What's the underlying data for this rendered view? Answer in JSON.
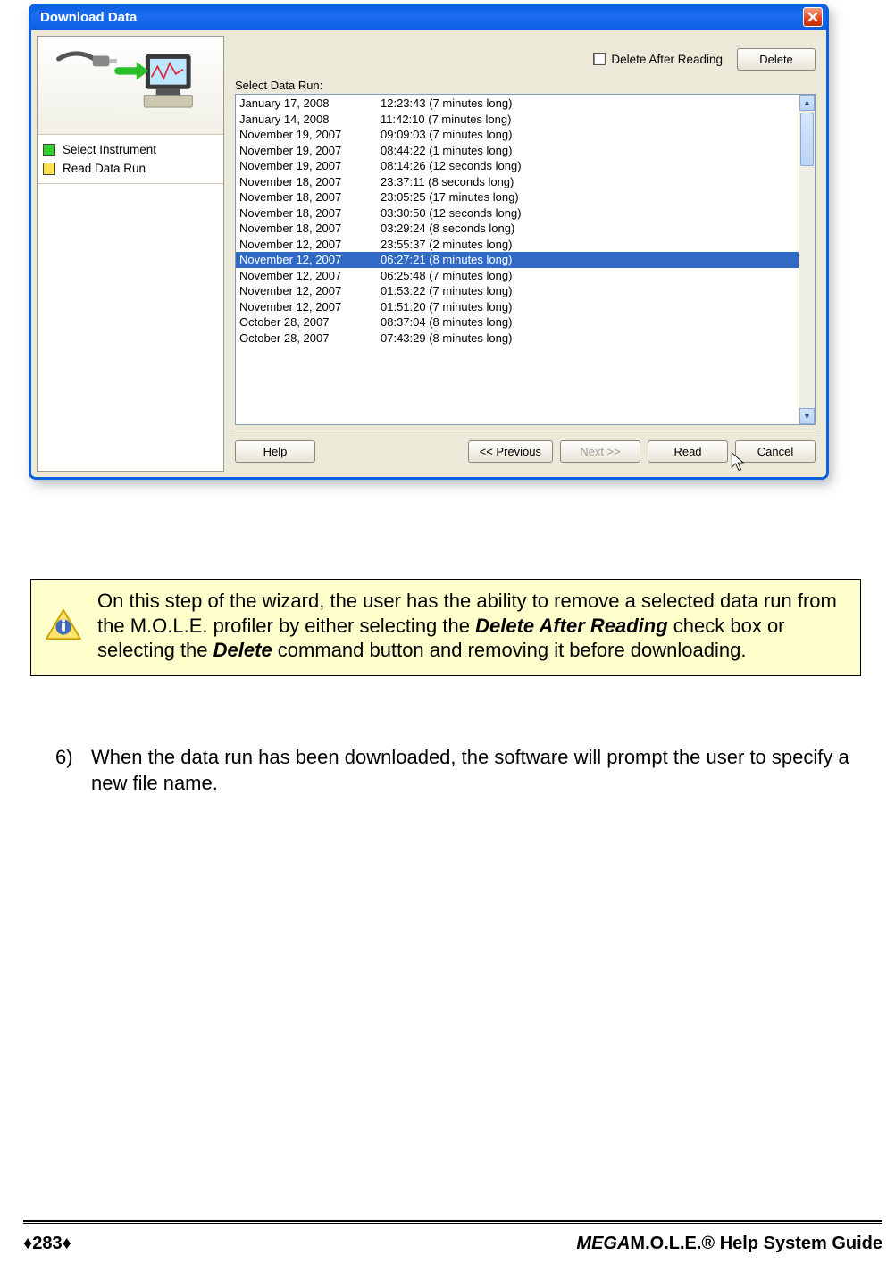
{
  "dialog": {
    "title": "Download Data",
    "steps": [
      {
        "color": "green",
        "label": "Select Instrument"
      },
      {
        "color": "yellow",
        "label": "Read Data Run"
      }
    ],
    "delete_after_reading_label": "Delete After Reading",
    "delete_button": "Delete",
    "select_label": "Select Data Run:",
    "rows": [
      {
        "date": "January 17, 2008",
        "detail": "12:23:43 (7 minutes long)"
      },
      {
        "date": "January 14, 2008",
        "detail": "11:42:10 (7 minutes long)"
      },
      {
        "date": "November 19, 2007",
        "detail": "09:09:03 (7 minutes long)"
      },
      {
        "date": "November 19, 2007",
        "detail": "08:44:22 (1 minutes long)"
      },
      {
        "date": "November 19, 2007",
        "detail": "08:14:26 (12 seconds long)"
      },
      {
        "date": "November 18, 2007",
        "detail": "23:37:11 (8 seconds long)"
      },
      {
        "date": "November 18, 2007",
        "detail": "23:05:25 (17 minutes long)"
      },
      {
        "date": "November 18, 2007",
        "detail": "03:30:50 (12 seconds long)"
      },
      {
        "date": "November 18, 2007",
        "detail": "03:29:24 (8 seconds long)"
      },
      {
        "date": "November 12, 2007",
        "detail": "23:55:37 (2 minutes long)"
      },
      {
        "date": "November 12, 2007",
        "detail": "06:27:21 (8 minutes long)",
        "selected": true
      },
      {
        "date": "November 12, 2007",
        "detail": "06:25:48 (7 minutes long)"
      },
      {
        "date": "November 12, 2007",
        "detail": "01:53:22 (7 minutes long)"
      },
      {
        "date": "November 12, 2007",
        "detail": "01:51:20 (7 minutes long)"
      },
      {
        "date": "October 28, 2007",
        "detail": "08:37:04 (8 minutes long)"
      },
      {
        "date": "October 28, 2007",
        "detail": "07:43:29 (8 minutes long)"
      }
    ],
    "buttons": {
      "help": "Help",
      "prev": "<< Previous",
      "next": "Next >>",
      "read": "Read",
      "cancel": "Cancel"
    }
  },
  "note": {
    "pre": "On this step of the wizard, the user has the ability to remove a selected data run from the M.O.L.E. profiler by either selecting the ",
    "bold1": "Delete After Reading",
    "mid": " check box or selecting the ",
    "bold2": "Delete",
    "post": " command button and removing it before downloading."
  },
  "step6": {
    "num": "6)",
    "text": "When the data run has been downloaded, the software will prompt the user to specify a new file name."
  },
  "footer": {
    "page": "♦283♦",
    "guide_prefix": "MEGA",
    "guide_rest": "M.O.L.E.® Help System Guide"
  }
}
